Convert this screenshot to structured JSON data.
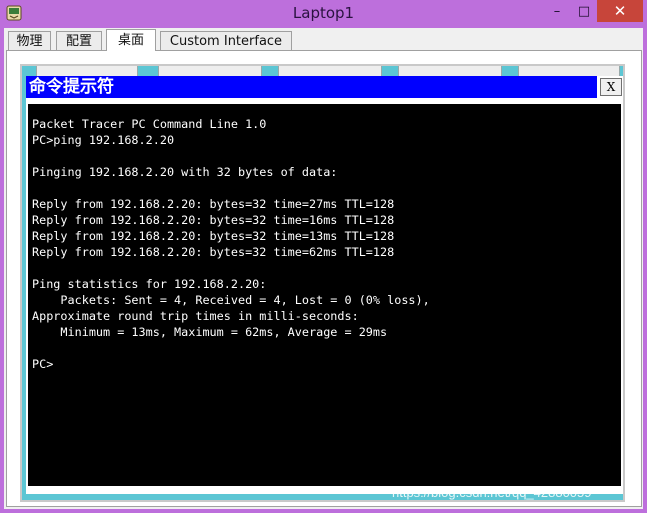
{
  "window": {
    "title": "Laptop1",
    "min_glyph": "–",
    "max_glyph": "□",
    "close_glyph": "✕"
  },
  "tabs": [
    {
      "label": "物理"
    },
    {
      "label": "配置"
    },
    {
      "label": "桌面"
    },
    {
      "label": "Custom Interface"
    }
  ],
  "active_tab": "桌面",
  "cmd": {
    "title": "命令提示符",
    "close_label": "X",
    "lines": [
      "Packet Tracer PC Command Line 1.0",
      "PC>ping 192.168.2.20",
      "",
      "Pinging 192.168.2.20 with 32 bytes of data:",
      "",
      "Reply from 192.168.2.20: bytes=32 time=27ms TTL=128",
      "Reply from 192.168.2.20: bytes=32 time=16ms TTL=128",
      "Reply from 192.168.2.20: bytes=32 time=13ms TTL=128",
      "Reply from 192.168.2.20: bytes=32 time=62ms TTL=128",
      "",
      "Ping statistics for 192.168.2.20:",
      "    Packets: Sent = 4, Received = 4, Lost = 0 (0% loss),",
      "Approximate round trip times in milli-seconds:",
      "    Minimum = 13ms, Maximum = 62ms, Average = 29ms",
      "",
      "PC>"
    ]
  },
  "watermark": "https://blog.csdn.net/qq_42880059",
  "colors": {
    "window_frame": "#bd6fdc",
    "cmd_titlebar": "#0000ff",
    "desktop_bg": "#5cc6d4",
    "terminal_bg": "#000000",
    "terminal_fg": "#ffffff",
    "close_button": "#c7453a"
  },
  "icons": {
    "app": "packet-tracer-laptop-icon"
  }
}
